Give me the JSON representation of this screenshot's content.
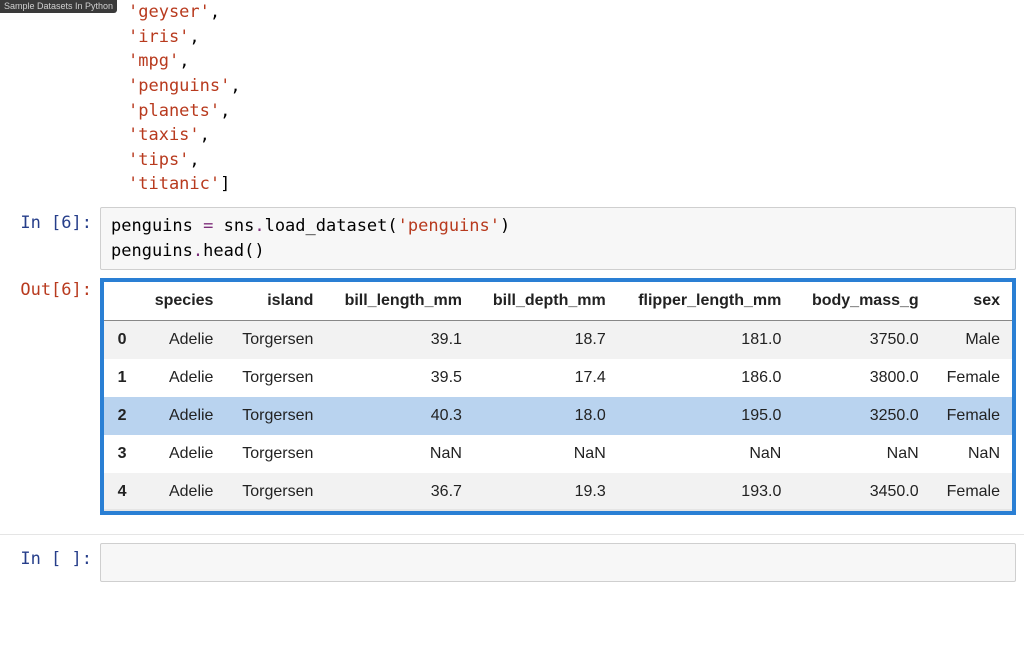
{
  "topbar": {
    "label": "Sample Datasets In Python"
  },
  "output_list": {
    "items": [
      "geyser",
      "iris",
      "mpg",
      "penguins",
      "planets",
      "taxis",
      "tips",
      "titanic"
    ]
  },
  "cell_load": {
    "prompt": "In [6]:",
    "code_tokens": [
      [
        {
          "t": "penguins ",
          "c": ""
        },
        {
          "t": "=",
          "c": "op"
        },
        {
          "t": " sns",
          "c": ""
        },
        {
          "t": ".",
          "c": "op"
        },
        {
          "t": "load_dataset(",
          "c": ""
        },
        {
          "t": "'penguins'",
          "c": "str"
        },
        {
          "t": ")",
          "c": ""
        }
      ],
      [
        {
          "t": "penguins",
          "c": ""
        },
        {
          "t": ".",
          "c": "op"
        },
        {
          "t": "head()",
          "c": ""
        }
      ]
    ]
  },
  "cell_out": {
    "prompt": "Out[6]:",
    "columns": [
      "species",
      "island",
      "bill_length_mm",
      "bill_depth_mm",
      "flipper_length_mm",
      "body_mass_g",
      "sex"
    ],
    "index": [
      "0",
      "1",
      "2",
      "3",
      "4"
    ],
    "rows": [
      [
        "Adelie",
        "Torgersen",
        "39.1",
        "18.7",
        "181.0",
        "3750.0",
        "Male"
      ],
      [
        "Adelie",
        "Torgersen",
        "39.5",
        "17.4",
        "186.0",
        "3800.0",
        "Female"
      ],
      [
        "Adelie",
        "Torgersen",
        "40.3",
        "18.0",
        "195.0",
        "3250.0",
        "Female"
      ],
      [
        "Adelie",
        "Torgersen",
        "NaN",
        "NaN",
        "NaN",
        "NaN",
        "NaN"
      ],
      [
        "Adelie",
        "Torgersen",
        "36.7",
        "19.3",
        "193.0",
        "3450.0",
        "Female"
      ]
    ],
    "selected_row": 2
  },
  "cell_empty": {
    "prompt": "In [ ]:"
  },
  "chart_data": {
    "type": "table",
    "title": "penguins.head()",
    "columns": [
      "species",
      "island",
      "bill_length_mm",
      "bill_depth_mm",
      "flipper_length_mm",
      "body_mass_g",
      "sex"
    ],
    "index": [
      0,
      1,
      2,
      3,
      4
    ],
    "rows": [
      [
        "Adelie",
        "Torgersen",
        39.1,
        18.7,
        181.0,
        3750.0,
        "Male"
      ],
      [
        "Adelie",
        "Torgersen",
        39.5,
        17.4,
        186.0,
        3800.0,
        "Female"
      ],
      [
        "Adelie",
        "Torgersen",
        40.3,
        18.0,
        195.0,
        3250.0,
        "Female"
      ],
      [
        "Adelie",
        "Torgersen",
        null,
        null,
        null,
        null,
        null
      ],
      [
        "Adelie",
        "Torgersen",
        36.7,
        19.3,
        193.0,
        3450.0,
        "Female"
      ]
    ]
  }
}
